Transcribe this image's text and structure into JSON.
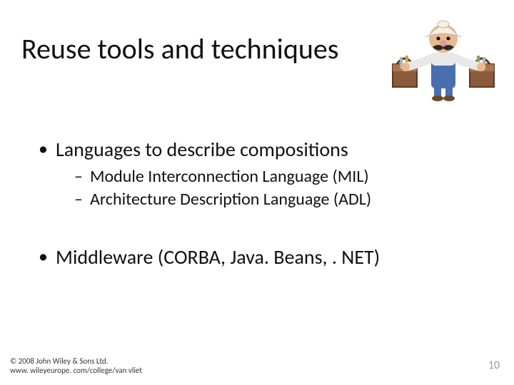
{
  "title": "Reuse tools and techniques",
  "bullets": {
    "item1": "Languages to describe compositions",
    "sub1": "Module Interconnection Language (MIL)",
    "sub2": "Architecture Description Language (ADL)",
    "item2": "Middleware (CORBA, Java. Beans, . NET)"
  },
  "footer": {
    "copyright": "© 2008 John Wiley & Sons Ltd.",
    "url": "www. wileyeurope. com/college/van vliet",
    "pageNumber": "10"
  },
  "clipart": {
    "name": "handyman-clipart",
    "alt": "Cartoon handyman with mustache and cap carrying two toolboxes"
  }
}
